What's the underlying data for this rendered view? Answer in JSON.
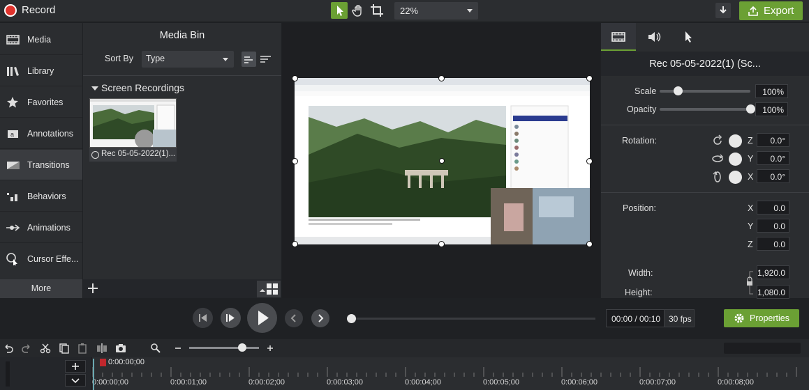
{
  "app": {
    "record_label": "Record",
    "export_label": "Export",
    "zoom_value": "22%"
  },
  "sidebar": {
    "items": [
      {
        "label": "Media",
        "icon": "film-icon"
      },
      {
        "label": "Library",
        "icon": "books-icon"
      },
      {
        "label": "Favorites",
        "icon": "star-icon"
      },
      {
        "label": "Annotations",
        "icon": "annotation-icon"
      },
      {
        "label": "Transitions",
        "icon": "transition-icon"
      },
      {
        "label": "Behaviors",
        "icon": "behaviors-icon"
      },
      {
        "label": "Animations",
        "icon": "animation-icon"
      },
      {
        "label": "Cursor Effe...",
        "icon": "cursor-effect-icon"
      }
    ],
    "more_label": "More"
  },
  "media_bin": {
    "title": "Media Bin",
    "sort_by_label": "Sort By",
    "sort_value": "Type",
    "section_label": "Screen Recordings",
    "clip_caption": "Rec 05-05-2022(1)..."
  },
  "properties": {
    "clip_title": "Rec 05-05-2022(1) (Sc...",
    "scale_label": "Scale",
    "scale_value": "100%",
    "scale_level": 0.2,
    "opacity_label": "Opacity",
    "opacity_value": "100%",
    "opacity_level": 1.0,
    "rotation_label": "Rotation:",
    "rot_z": "0.0°",
    "rot_y": "0.0°",
    "rot_x": "0.0°",
    "position_label": "Position:",
    "pos_x": "0.0",
    "pos_y": "0.0",
    "pos_z": "0.0",
    "width_label": "Width:",
    "width_value": "1,920.0",
    "height_label": "Height:",
    "height_value": "1,080.0",
    "axis_z": "Z",
    "axis_y": "Y",
    "axis_x": "X"
  },
  "playback": {
    "time": "00:00 / 00:10",
    "fps": "30 fps",
    "properties_label": "Properties"
  },
  "timeline": {
    "playhead_time": "0:00:00;00",
    "ticks": [
      "0:00:00;00",
      "0:00:01;00",
      "0:00:02;00",
      "0:00:03;00",
      "0:00:04;00",
      "0:00:05;00",
      "0:00:06;00",
      "0:00:07;00",
      "0:00:08;00"
    ]
  }
}
